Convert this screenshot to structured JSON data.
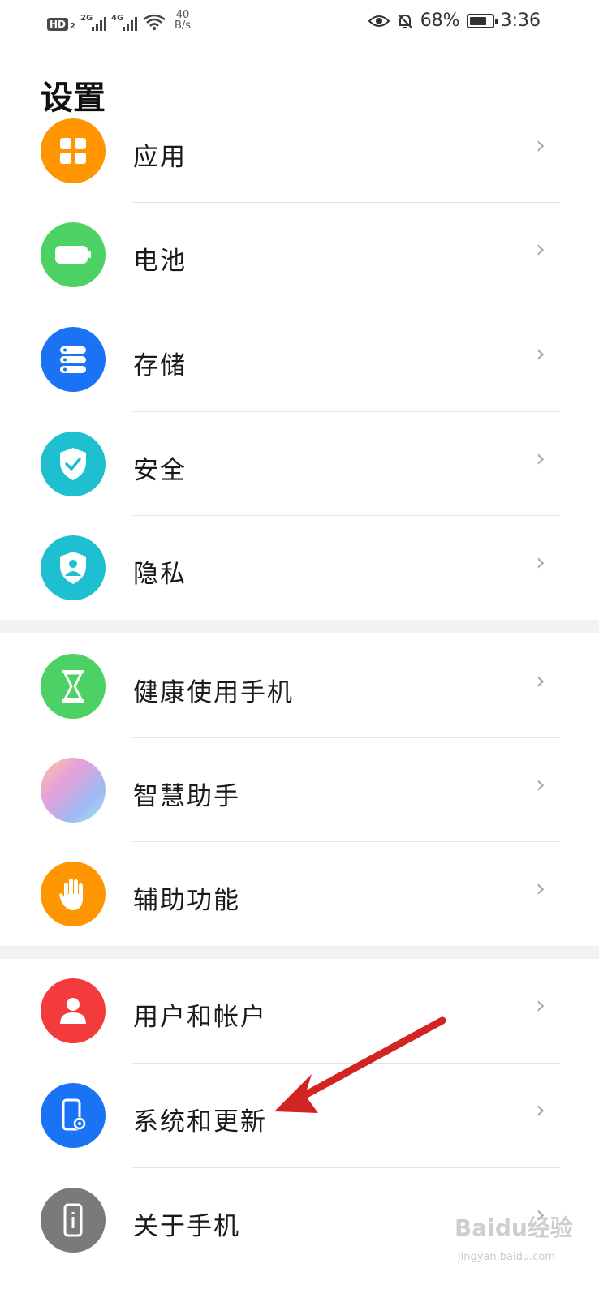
{
  "status_bar": {
    "hd_badge": "HD",
    "sim_number": "2",
    "network_1": "2G",
    "network_2": "4G",
    "speed_value": "40",
    "speed_unit": "B/s",
    "battery_percent": "68%",
    "time": "3:36",
    "icons": [
      "hd-icon",
      "signal-icon",
      "signal-icon",
      "wifi-icon",
      "eye-icon",
      "bell-off-icon",
      "battery-icon"
    ]
  },
  "page": {
    "title": "设置"
  },
  "items": [
    {
      "label": "应用",
      "icon": "apps-icon",
      "color": "#FF9500"
    },
    {
      "label": "电池",
      "icon": "battery-icon",
      "color": "#4CD264"
    },
    {
      "label": "存储",
      "icon": "storage-icon",
      "color": "#1A73F5"
    },
    {
      "label": "安全",
      "icon": "shield-check-icon",
      "color": "#1DBFD0"
    },
    {
      "label": "隐私",
      "icon": "privacy-icon",
      "color": "#1DBFD0"
    },
    {
      "label": "健康使用手机",
      "icon": "hourglass-icon",
      "color": "#4CD264"
    },
    {
      "label": "智慧助手",
      "icon": "assistant-icon",
      "color": "#E8A6D8"
    },
    {
      "label": "辅助功能",
      "icon": "hand-icon",
      "color": "#FF9500"
    },
    {
      "label": "用户和帐户",
      "icon": "user-icon",
      "color": "#F43B3B"
    },
    {
      "label": "系统和更新",
      "icon": "system-update-icon",
      "color": "#1A73F5"
    },
    {
      "label": "关于手机",
      "icon": "phone-info-icon",
      "color": "#7A7A7A"
    }
  ],
  "chevron": "›",
  "watermark": {
    "text": "Baidu经验",
    "sub": "jingyan.baidu.com"
  },
  "annotation_color": "#D32424"
}
